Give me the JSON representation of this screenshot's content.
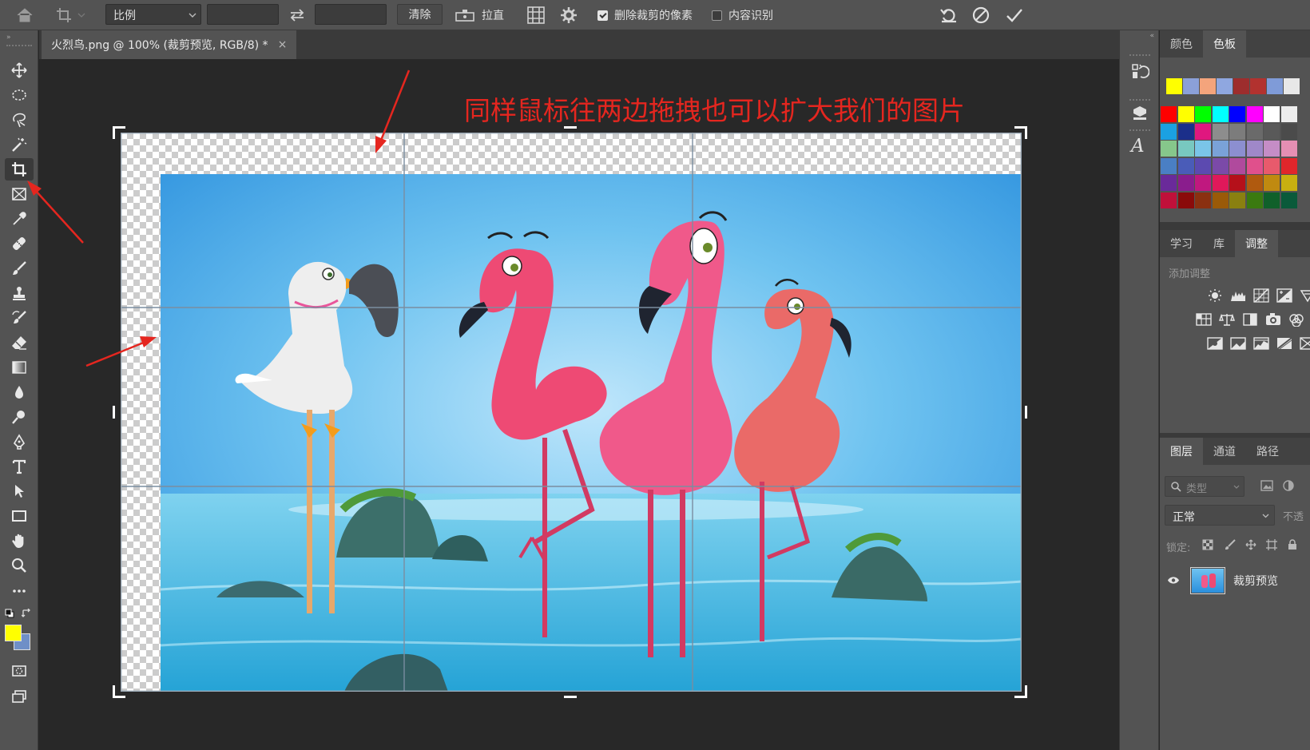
{
  "options_bar": {
    "ratio_label": "比例",
    "ratio_width": "",
    "ratio_height": "",
    "clear_button": "清除",
    "straighten_button": "拉直",
    "delete_cropped_label": "删除裁剪的像素",
    "delete_cropped_checked": true,
    "content_aware_label": "内容识别",
    "content_aware_checked": false
  },
  "document_tab": {
    "title": "火烈鸟.png @ 100% (裁剪预览, RGB/8) *",
    "close": "×"
  },
  "annotation": "同样鼠标往两边拖拽也可以扩大我们的图片",
  "tools": [
    "move-tool",
    "marquee-tool",
    "lasso-tool",
    "magic-wand-tool",
    "crop-tool",
    "frame-tool",
    "eyedropper-tool",
    "healing-brush-tool",
    "brush-tool",
    "clone-stamp-tool",
    "history-brush-tool",
    "eraser-tool",
    "gradient-tool",
    "blur-tool",
    "dodge-tool",
    "pen-tool",
    "type-tool",
    "path-selection-tool",
    "rectangle-tool",
    "hand-tool",
    "zoom-tool",
    "more-tools"
  ],
  "colors": {
    "foreground": "#ffff00",
    "background": "#6f8fc7",
    "accent_red": "#e5261f"
  },
  "swatches_panel": {
    "tabs": [
      "颜色",
      "色板"
    ],
    "active_tab": "色板",
    "recent": [
      "#ffff00",
      "#8ba0d8",
      "#f4a47c",
      "#8fa7e0",
      "#9d2d2d",
      "#b2322f",
      "#7f9bd8",
      "#e8e8e8"
    ],
    "grid": [
      [
        "#ff0000",
        "#ffff00",
        "#00ff00",
        "#00ffff",
        "#0000ff",
        "#ff00ff",
        "#ffffff",
        "#ededed"
      ],
      [
        "#1ba1e2",
        "#1b2f8a",
        "#e0177f",
        "#8d8d8d",
        "#7c7c7c",
        "#6a6a6a",
        "#595959",
        "#4b4b4b"
      ],
      [
        "#86c78b",
        "#78c8c0",
        "#7ac5e8",
        "#7aa2d8",
        "#8c8fd0",
        "#9f88c9",
        "#c58dc6",
        "#e58fb3"
      ],
      [
        "#4a7fc4",
        "#4a5cb8",
        "#5c4ab0",
        "#7b4aa8",
        "#b04a9d",
        "#e0508c",
        "#e85a6c",
        "#e0262b"
      ],
      [
        "#6a2a9a",
        "#8a1d8d",
        "#c0187f",
        "#e0185a",
        "#b5101a",
        "#b05a0f",
        "#c08a10",
        "#c8b010"
      ],
      [
        "#c0103a",
        "#8a0a0a",
        "#8a3010",
        "#9a5a08",
        "#8a8010",
        "#3a7a10",
        "#10602a",
        "#0a5a3a"
      ]
    ]
  },
  "adjustments_panel": {
    "tabs": [
      "学习",
      "库",
      "调整"
    ],
    "active_tab": "调整",
    "add_label": "添加调整",
    "icons": [
      "brightness-icon",
      "levels-icon",
      "curves-icon",
      "exposure-icon",
      "vibrance-icon",
      "hue-saturation-icon",
      "color-balance-icon",
      "black-white-icon",
      "photo-filter-icon",
      "channel-mixer-icon",
      "invert-icon",
      "posterize-icon",
      "threshold-icon",
      "gradient-map-icon",
      "selective-color-icon"
    ]
  },
  "layers_panel": {
    "tabs": [
      "图层",
      "通道",
      "路径"
    ],
    "active_tab": "图层",
    "filter_label": "类型",
    "blend_mode": "正常",
    "opacity_label": "不透",
    "lock_label": "锁定:",
    "layers": [
      {
        "name": "裁剪预览",
        "visible": true
      }
    ]
  }
}
